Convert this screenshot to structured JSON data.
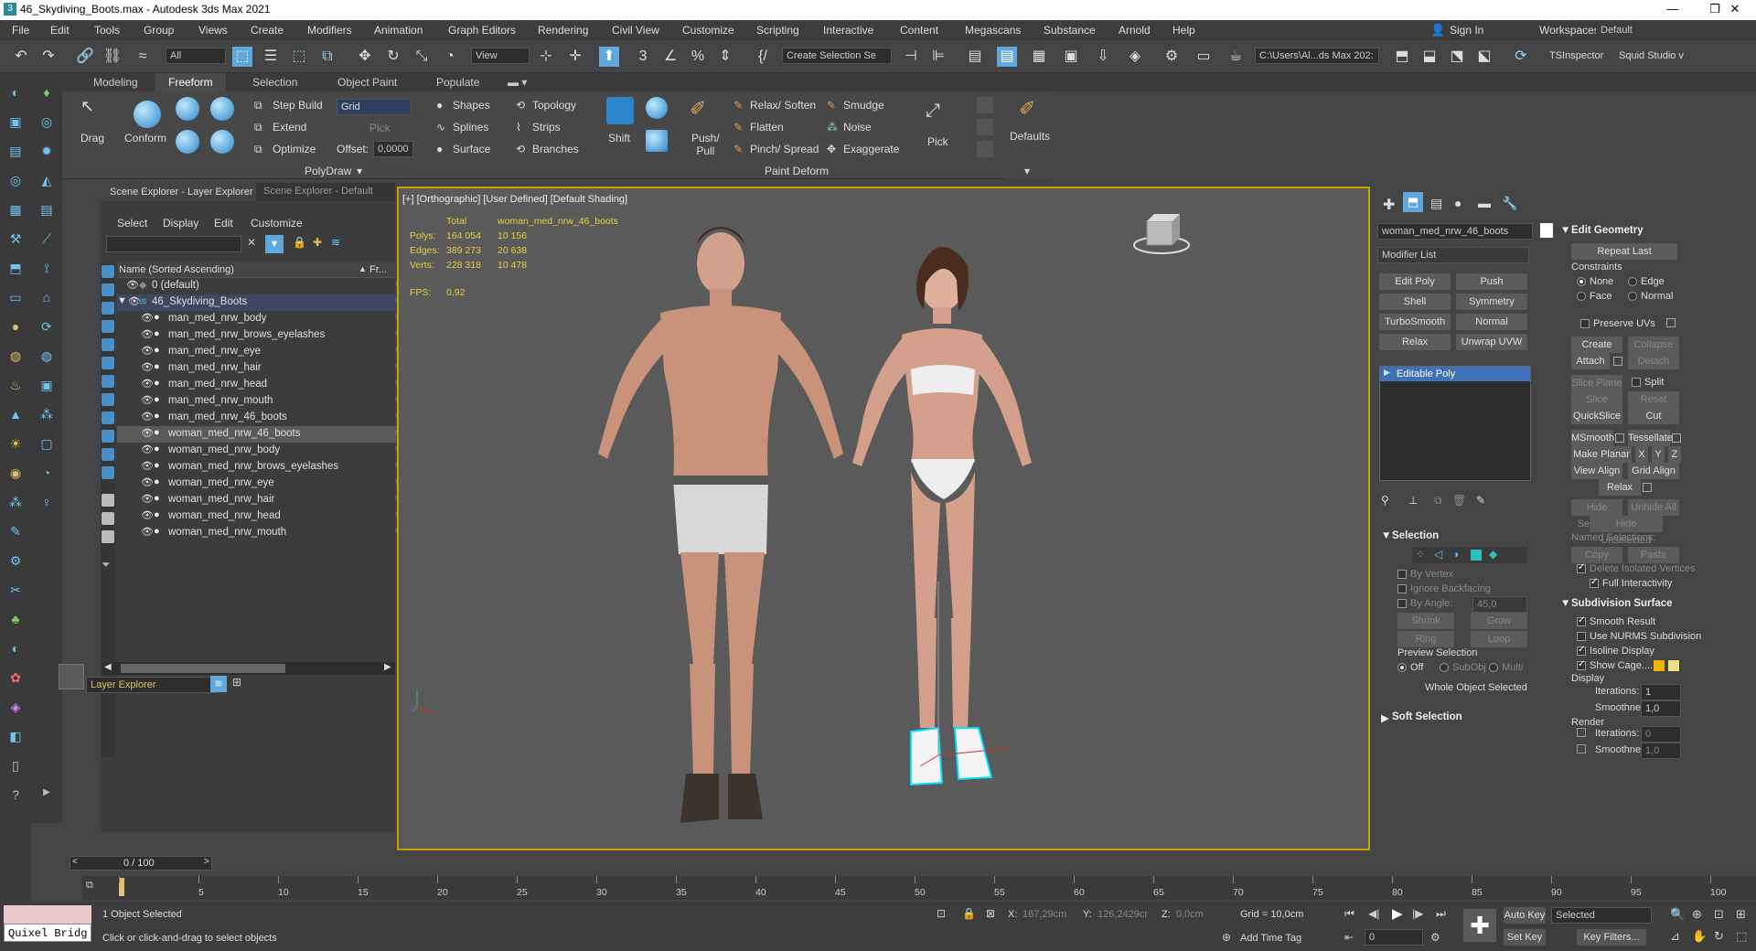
{
  "titlebar": {
    "title": "46_Skydiving_Boots.max - Autodesk 3ds Max 2021"
  },
  "menu": [
    "File",
    "Edit",
    "Tools",
    "Group",
    "Views",
    "Create",
    "Modifiers",
    "Animation",
    "Graph Editors",
    "Rendering",
    "Civil View",
    "Customize",
    "Scripting",
    "Interactive",
    "Content",
    "Megascans",
    "Substance",
    "Arnold",
    "Help"
  ],
  "account": {
    "sign_in": "Sign In",
    "workspaces_label": "Workspaces:",
    "workspace": "Default"
  },
  "toolbar": {
    "filter": "All",
    "view": "View",
    "selection_set": "Create Selection Se",
    "path": "C:\\Users\\Al...ds Max 202:",
    "tsinspector": "TSInspector",
    "squid": "Squid Studio v"
  },
  "ribbon": {
    "tabs": [
      "Modeling",
      "Freeform",
      "Selection",
      "Object Paint",
      "Populate"
    ],
    "drag": "Drag",
    "conform": "Conform",
    "step_build": "Step Build",
    "extend": "Extend",
    "optimize": "Optimize",
    "grid": "Grid",
    "pick_grid": "Pick",
    "offset_label": "Offset:",
    "offset": "0,0000",
    "shapes": "Shapes",
    "splines": "Splines",
    "surface": "Surface",
    "topology": "Topology",
    "strips": "Strips",
    "branches": "Branches",
    "polydraw": "PolyDraw",
    "shift": "Shift",
    "push_pull": "Push/\nPull",
    "relax_soften": "Relax/ Soften",
    "flatten": "Flatten",
    "pinch_spread": "Pinch/ Spread",
    "smudge": "Smudge",
    "noise": "Noise",
    "exaggerate": "Exaggerate",
    "paint_deform": "Paint Deform",
    "pick": "Pick",
    "defaults": "Defaults"
  },
  "scene_explorer": {
    "tabs": [
      "Scene Explorer - Layer Explorer",
      "Scene Explorer - Default"
    ],
    "menu": [
      "Select",
      "Display",
      "Edit",
      "Customize"
    ],
    "col_name": "Name (Sorted Ascending)",
    "col_fr": "Fr...",
    "layers": [
      "0 (default)",
      "46_Skydiving_Boots"
    ],
    "items": [
      "man_med_nrw_body",
      "man_med_nrw_brows_eyelashes",
      "man_med_nrw_eye",
      "man_med_nrw_hair",
      "man_med_nrw_head",
      "man_med_nrw_mouth",
      "man_med_nrw_46_boots",
      "woman_med_nrw_46_boots",
      "woman_med_nrw_body",
      "woman_med_nrw_brows_eyelashes",
      "woman_med_nrw_eye",
      "woman_med_nrw_hair",
      "woman_med_nrw_head",
      "woman_med_nrw_mouth"
    ],
    "selected_index": 7,
    "footer": "Layer Explorer"
  },
  "viewport": {
    "label": "[+] [Orthographic] [User Defined] [Default Shading]",
    "stats_header_total": "Total",
    "stats_header_obj": "woman_med_nrw_46_boots",
    "polys_label": "Polys:",
    "polys_total": "164 054",
    "polys_obj": "10 156",
    "edges_label": "Edges:",
    "edges_total": "389 273",
    "edges_obj": "20 638",
    "verts_label": "Verts:",
    "verts_total": "228 318",
    "verts_obj": "10 478",
    "fps_label": "FPS:",
    "fps": "0,92"
  },
  "command_panel": {
    "object_name": "woman_med_nrw_46_boots",
    "modifier_list": "Modifier List",
    "mod_buttons": [
      "Edit Poly",
      "Push",
      "Shell",
      "Symmetry",
      "TurboSmooth",
      "Normal",
      "Relax",
      "Unwrap UVW"
    ],
    "stack_item": "Editable Poly",
    "selection": {
      "title": "Selection",
      "by_vertex": "By Vertex",
      "ignore_backfacing": "Ignore Backfacing",
      "by_angle": "By Angle:",
      "angle": "45,0",
      "shrink": "Shrink",
      "grow": "Grow",
      "ring": "Ring",
      "loop": "Loop",
      "preview": "Preview Selection",
      "off": "Off",
      "subobj": "SubObj",
      "multi": "Multi",
      "whole": "Whole Object Selected"
    },
    "soft_selection": "Soft Selection",
    "edit_geometry": {
      "title": "Edit Geometry",
      "repeat_last": "Repeat Last",
      "constraints": "Constraints",
      "none": "None",
      "edge": "Edge",
      "face": "Face",
      "normal": "Normal",
      "preserve_uvs": "Preserve UVs",
      "create": "Create",
      "collapse": "Collapse",
      "attach": "Attach",
      "detach": "Detach",
      "slice_plane": "Slice Plane",
      "split": "Split",
      "slice": "Slice",
      "reset_plane": "Reset Plane",
      "quickslice": "QuickSlice",
      "cut": "Cut",
      "msmooth": "MSmooth",
      "tessellate": "Tessellate",
      "make_planar": "Make Planar",
      "x": "X",
      "y": "Y",
      "z": "Z",
      "view_align": "View Align",
      "grid_align": "Grid Align",
      "relax": "Relax",
      "hide_selected": "Hide Selected",
      "unhide_all": "Unhide All",
      "hide_unselected": "Hide Unselected",
      "named_selections": "Named Selections:",
      "copy": "Copy",
      "paste": "Paste",
      "delete_isolated": "Delete Isolated Vertices",
      "full_interactivity": "Full Interactivity"
    },
    "subdivision": {
      "title": "Subdivision Surface",
      "smooth_result": "Smooth Result",
      "use_nurms": "Use NURMS Subdivision",
      "isoline": "Isoline Display",
      "show_cage": "Show Cage......",
      "display": "Display",
      "iterations": "Iterations:",
      "iter_val": "1",
      "smoothness": "Smoothness:",
      "smooth_val": "1,0",
      "render": "Render",
      "r_iter_val": "0",
      "r_smooth_val": "1,0"
    }
  },
  "timeline": {
    "frame": "0 / 100",
    "ticks": [
      "0",
      "5",
      "10",
      "15",
      "20",
      "25",
      "30",
      "35",
      "40",
      "45",
      "50",
      "55",
      "60",
      "65",
      "70",
      "75",
      "80",
      "85",
      "90",
      "95",
      "100"
    ]
  },
  "status": {
    "script": "Quixel Bridg",
    "selected": "1 Object Selected",
    "hint": "Click or click-and-drag to select objects",
    "x_label": "X:",
    "x": "167,29cm",
    "y_label": "Y:",
    "y": "126,2429cr",
    "z_label": "Z:",
    "z": "0,0cm",
    "grid": "Grid = 10,0cm",
    "add_time_tag": "Add Time Tag",
    "auto_key": "Auto Key",
    "set_key": "Set Key",
    "selected_dd": "Selected",
    "key_filters": "Key Filters...",
    "frame_field": "0"
  }
}
